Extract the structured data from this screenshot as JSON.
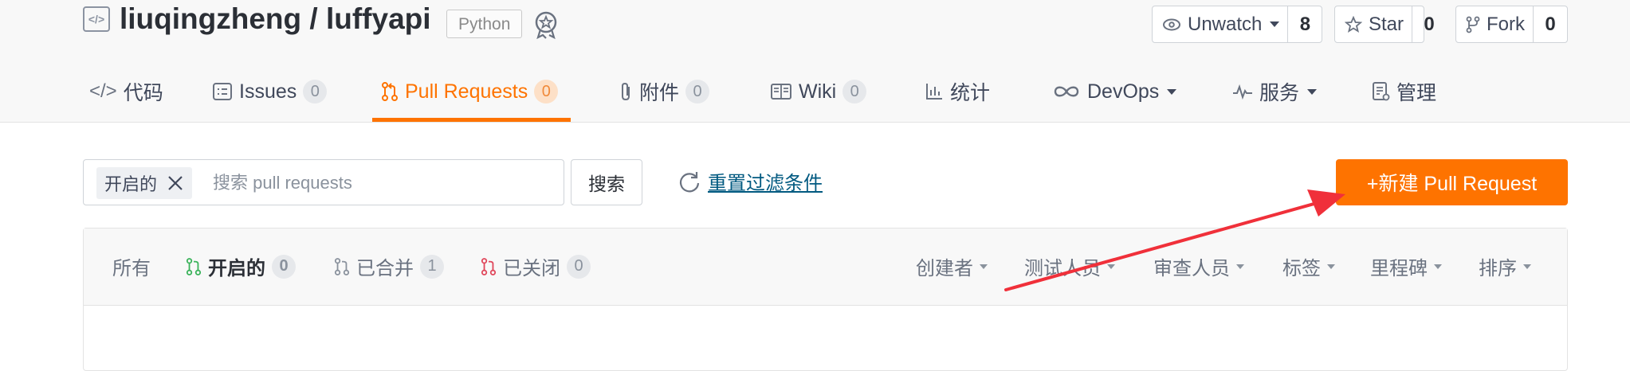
{
  "repo": {
    "owner": "liuqingzheng",
    "separator": "/",
    "name": "luffyapi",
    "language": "Python"
  },
  "actions": {
    "watch": {
      "label": "Unwatch",
      "count": "8"
    },
    "star": {
      "label": "Star",
      "count": "0"
    },
    "fork": {
      "label": "Fork",
      "count": "0"
    }
  },
  "tabs": [
    {
      "label": "代码",
      "icon": "code-icon"
    },
    {
      "label": "Issues",
      "count": "0",
      "icon": "issues-icon"
    },
    {
      "label": "Pull Requests",
      "count": "0",
      "icon": "pull-request-icon",
      "active": true
    },
    {
      "label": "附件",
      "count": "0",
      "icon": "attachment-icon"
    },
    {
      "label": "Wiki",
      "count": "0",
      "icon": "wiki-icon"
    },
    {
      "label": "统计",
      "icon": "stats-icon"
    },
    {
      "label": "DevOps",
      "icon": "devops-icon"
    },
    {
      "label": "服务",
      "icon": "service-icon"
    },
    {
      "label": "管理",
      "icon": "manage-icon"
    }
  ],
  "search": {
    "chip": "开启的",
    "placeholder": "搜索 pull requests",
    "button": "搜索",
    "reset": "重置过滤条件"
  },
  "new_pr": {
    "label": "+新建 Pull Request"
  },
  "state_filters": [
    {
      "label": "所有"
    },
    {
      "label": "开启的",
      "count": "0",
      "active": true
    },
    {
      "label": "已合并",
      "count": "1"
    },
    {
      "label": "已关闭",
      "count": "0"
    }
  ],
  "dropdowns": [
    "创建者",
    "测试人员",
    "审查人员",
    "标签",
    "里程碑",
    "排序"
  ],
  "colors": {
    "accent": "#fe7300",
    "link": "#005980",
    "annotation_arrow": "#f0303a"
  }
}
